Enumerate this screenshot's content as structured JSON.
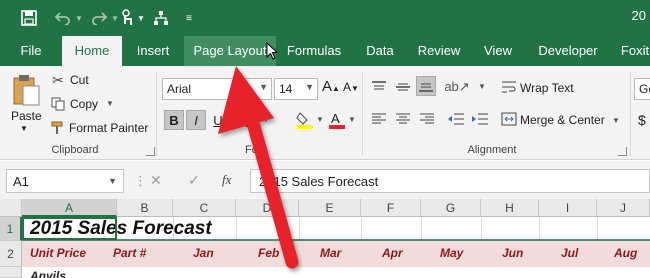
{
  "app": {
    "title_fragment": "20"
  },
  "qat": {
    "save_icon": "save-icon",
    "undo_icon": "undo-icon",
    "redo_icon": "redo-icon",
    "touch_icon": "touch-mode-icon",
    "tree_icon": "org-chart-icon",
    "customize_icon": "customize-qat-icon"
  },
  "tabs": [
    "File",
    "Home",
    "Insert",
    "Page Layout",
    "Formulas",
    "Data",
    "Review",
    "View",
    "Developer",
    "Foxit"
  ],
  "active_tab": "Home",
  "hover_tab": "Page Layout",
  "clipboard": {
    "paste": "Paste",
    "cut": "Cut",
    "copy": "Copy",
    "format_painter": "Format Painter",
    "label": "Clipboard"
  },
  "font": {
    "name": "Arial",
    "size": "14",
    "bold": "B",
    "italic": "I",
    "underline": "U",
    "label": "Font"
  },
  "alignment": {
    "wrap_text": "Wrap Text",
    "merge_center": "Merge & Center",
    "label": "Alignment"
  },
  "number": {
    "format_fragment": "Ge"
  },
  "formula_bar": {
    "name_box": "A1",
    "fx": "fx",
    "content": "2015 Sales Forecast"
  },
  "columns": [
    "A",
    "B",
    "C",
    "D",
    "E",
    "F",
    "G",
    "H",
    "I",
    "J"
  ],
  "rows": [
    "1",
    "2"
  ],
  "sheet": {
    "title": "2015 Sales Forecast",
    "headers": [
      "Unit Price",
      "Part #",
      "Jan",
      "Feb",
      "Mar",
      "Apr",
      "May",
      "Jun",
      "Jul",
      "Aug"
    ],
    "row3_fragment": "Anvils"
  },
  "colors": {
    "excel_green": "#217346",
    "header_row_fill": "#f2dcdb",
    "header_text": "#8b1a1a",
    "arrow": "#e8242a"
  }
}
